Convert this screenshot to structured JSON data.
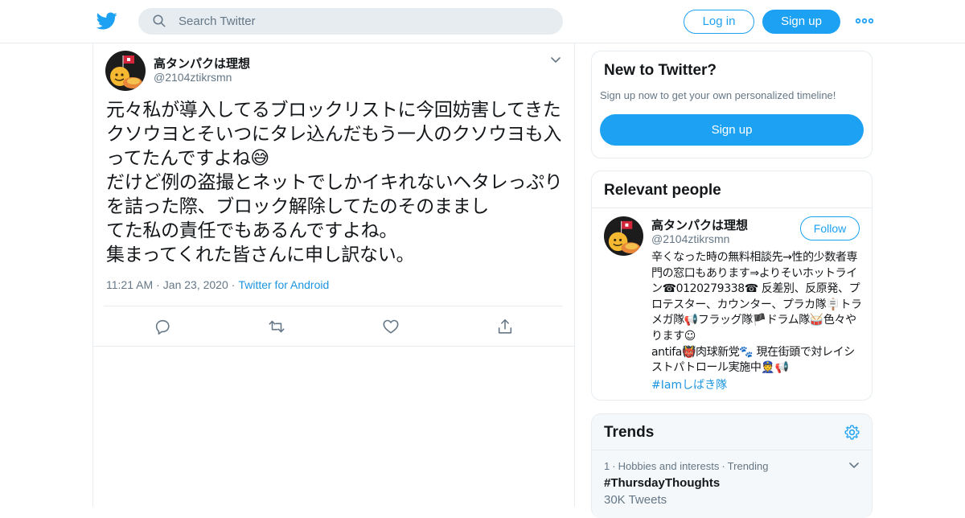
{
  "header": {
    "search_placeholder": "Search Twitter",
    "login_label": "Log in",
    "signup_label": "Sign up"
  },
  "tweet": {
    "author_name": "高タンパクは理想",
    "author_handle": "@2104ztikrsmn",
    "text": "元々私が導入してるブロックリストに今回妨害してきたクソウヨとそいつにタレ込んだもう一人のクソウヨも入ってたんですよね😅\nだけど例の盗撮とネットでしかイキれないヘタレっぷりを詰った際、ブロック解除してたのそのままし\nてた私の責任でもあるんですよね。\n集まってくれた皆さんに申し訳ない。",
    "time": "11:21 AM",
    "date": "Jan 23, 2020",
    "source": "Twitter for Android",
    "actions": [
      "reply-icon",
      "retweet-icon",
      "like-icon",
      "share-icon"
    ]
  },
  "sidebar": {
    "new_to_twitter": {
      "title": "New to Twitter?",
      "subtitle": "Sign up now to get your own personalized timeline!",
      "signup_label": "Sign up"
    },
    "relevant_people": {
      "title": "Relevant people",
      "name": "高タンパクは理想",
      "handle": "@2104ztikrsmn",
      "follow_label": "Follow",
      "bio": "辛くなった時の無料相談先→性的少数者専門の窓口もあります⇒よりそいホットライン☎0120279338☎ 反差別、反原発、プロテスター、カウンター、プラカ隊🪧トラメガ隊📢フラッグ隊🏴ドラム隊🥁色々やります☺\nantifa👹肉球新党🐾 現在街頭で対レイシストパトロール実施中👮📢",
      "hashtag": "#Iamしばき隊"
    },
    "trends": {
      "title": "Trends",
      "items": [
        {
          "rank": "1",
          "category": "Hobbies and interests",
          "status": "Trending",
          "name": "#ThursdayThoughts",
          "count": "30K Tweets"
        }
      ]
    }
  },
  "colors": {
    "accent": "#1da1f2",
    "link": "#1b95e0",
    "secondary_text": "#657786",
    "border": "#e6ecf0"
  }
}
